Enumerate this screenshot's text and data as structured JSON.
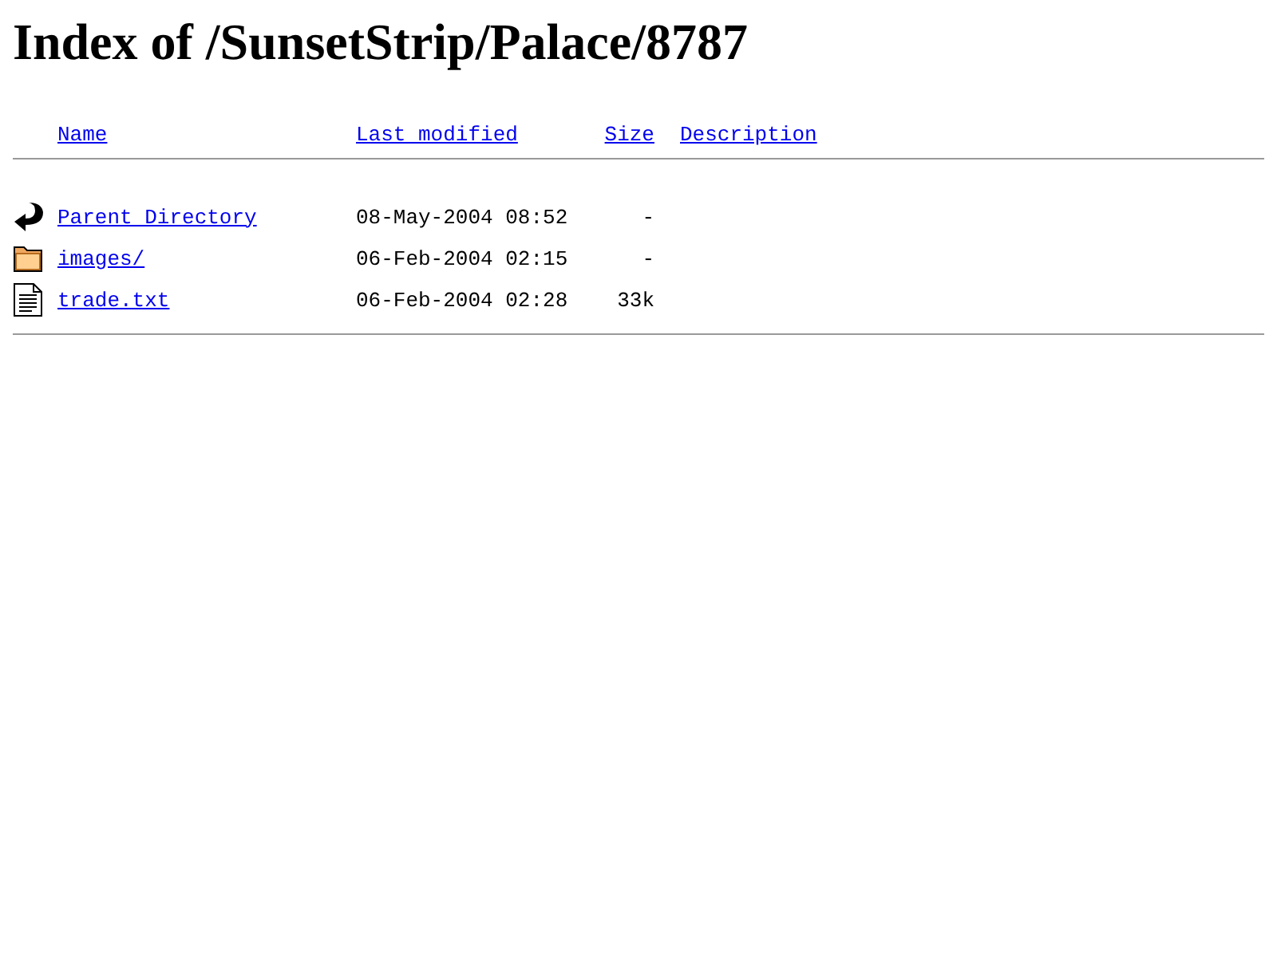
{
  "title": "Index of /SunsetStrip/Palace/8787",
  "columns": [
    {
      "label": "Name"
    },
    {
      "label": "Last modified"
    },
    {
      "label": "Size"
    },
    {
      "label": "Description"
    }
  ],
  "rows": [
    {
      "kind": "back",
      "name": "Parent Directory",
      "modified": "08-May-2004 08:52",
      "size": "-"
    },
    {
      "kind": "folder",
      "name": "images/",
      "modified": "06-Feb-2004 02:15",
      "size": "-"
    },
    {
      "kind": "text",
      "name": "trade.txt",
      "modified": "06-Feb-2004 02:28",
      "size": "33k"
    }
  ]
}
